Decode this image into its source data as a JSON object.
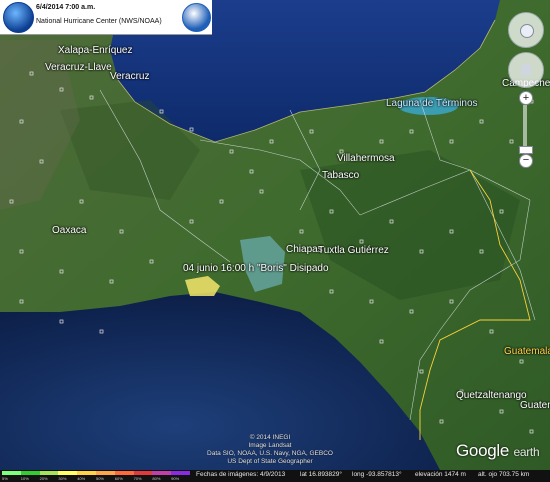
{
  "header": {
    "timestamp": "6/4/2014 7:00 a.m.",
    "center": "National Hurricane Center (NWS/NOAA)",
    "left_logo": "noaa-logo",
    "right_logo": "nws-logo"
  },
  "labels": {
    "xalapa": "Xalapa-Enríquez",
    "veracruz_llave": "Veracruz-Llave",
    "veracruz": "Veracruz",
    "campeche": "Campeche",
    "laguna": "Laguna de Términos",
    "villahermosa": "Villahermosa",
    "tabasco": "Tabasco",
    "oaxaca": "Oaxaca",
    "chiapas": "Chiapas",
    "tuxtla": "Tuxtla Gutiérrez",
    "guatemala": "Guatemala",
    "quetzaltenango": "Quetzaltenango",
    "guatemala_city": "Guatem"
  },
  "storm": {
    "label": "04 junio 16:00 h \"Boris\" Disipado"
  },
  "attribution": {
    "line1": "© 2014 INEGI",
    "line2": "Image Landsat",
    "line3": "Data SIO, NOAA, U.S. Navy, NGA, GEBCO",
    "line4": "US Dept of State Geographer",
    "brand": "Google",
    "brand_suffix": "earth"
  },
  "status": {
    "imagery_date": "Fechas de imágenes: 4/9/2013",
    "lat": "lat  16.893829°",
    "long": "long  -93.857813°",
    "elevation": "elevación  1474 m",
    "eye_alt": "alt. ojo 703.75 km"
  },
  "legend": {
    "colors": [
      "#7cff7c",
      "#33cc33",
      "#a6e35a",
      "#ffff66",
      "#ffd24a",
      "#ffa64d",
      "#ff6a3d",
      "#e0393e",
      "#c13fa8",
      "#8a2be2"
    ],
    "ticks": [
      "5%",
      "10%",
      "20%",
      "30%",
      "40%",
      "50%",
      "60%",
      "70%",
      "80%",
      "90%"
    ]
  },
  "icons": {
    "nav_look": "look-around-icon",
    "nav_move": "move-hand-icon",
    "zoom_in": "zoom-in-icon",
    "zoom_out": "zoom-out-icon"
  }
}
